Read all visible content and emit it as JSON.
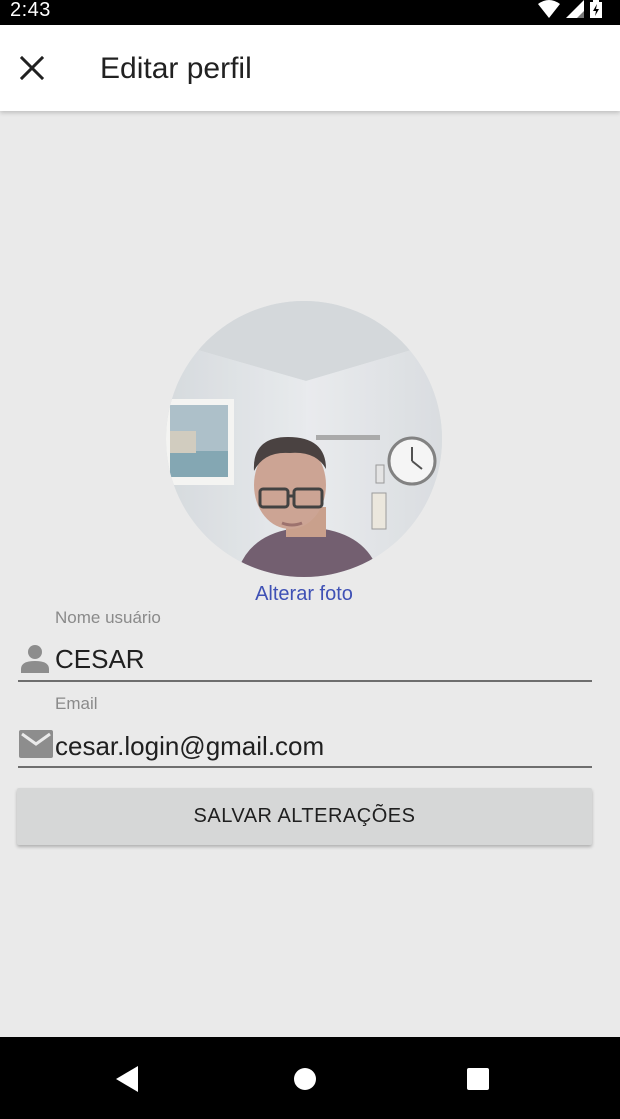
{
  "status_bar": {
    "time": "2:43",
    "icons": [
      "wifi-icon",
      "signal-icon",
      "battery-charging-icon"
    ]
  },
  "app_bar": {
    "title": "Editar perfil",
    "close_icon": "close-icon"
  },
  "profile": {
    "change_photo_label": "Alterar foto"
  },
  "form": {
    "username": {
      "label": "Nome usuário",
      "value": "CESAR",
      "icon": "person-icon"
    },
    "email": {
      "label": "Email",
      "value": "cesar.login@gmail.com",
      "icon": "mail-icon"
    },
    "save_label": "SALVAR ALTERAÇÕES"
  },
  "nav_bar": {
    "buttons": [
      "back-icon",
      "home-icon",
      "recents-icon"
    ]
  },
  "colors": {
    "accent": "#3f51b5",
    "background": "#eaeaea",
    "button": "#d6d7d7"
  }
}
